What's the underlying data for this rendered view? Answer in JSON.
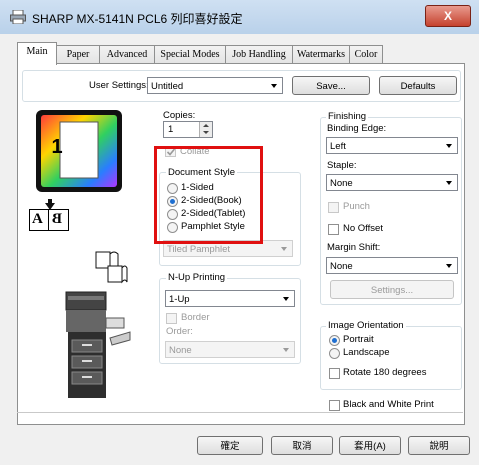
{
  "window": {
    "title": "SHARP MX-5141N PCL6 列印喜好設定",
    "close_label": "X"
  },
  "tabs": [
    "Main",
    "Paper",
    "Advanced",
    "Special Modes",
    "Job Handling",
    "Watermarks",
    "Color"
  ],
  "user_settings": {
    "label": "User Settings:",
    "value": "Untitled",
    "save_label": "Save...",
    "defaults_label": "Defaults"
  },
  "preview": {
    "page_number": "1",
    "book_letter_a": "A",
    "book_letter_b": "B"
  },
  "copies": {
    "label": "Copies:",
    "value": "1",
    "collate_label": "Collate"
  },
  "document_style": {
    "title": "Document Style",
    "options": [
      "1-Sided",
      "2-Sided(Book)",
      "2-Sided(Tablet)",
      "Pamphlet Style"
    ],
    "selected": "2-Sided(Book)",
    "hidden_combo_value": "Tiled Pamphlet"
  },
  "nup": {
    "title": "N-Up Printing",
    "value": "1-Up",
    "border_label": "Border",
    "order_label": "Order:",
    "order_value": "None"
  },
  "finishing": {
    "title": "Finishing",
    "binding_label": "Binding Edge:",
    "binding_value": "Left",
    "staple_label": "Staple:",
    "staple_value": "None",
    "punch_label": "Punch",
    "no_offset_label": "No Offset",
    "margin_label": "Margin Shift:",
    "margin_value": "None",
    "settings_label": "Settings..."
  },
  "orientation": {
    "title": "Image Orientation",
    "portrait": "Portrait",
    "landscape": "Landscape",
    "rotate_label": "Rotate 180 degrees"
  },
  "bw_label": "Black and White Print",
  "footer": {
    "ok": "確定",
    "cancel": "取消",
    "apply": "套用(A)",
    "help": "說明"
  },
  "colors": {
    "highlight": "#e01010",
    "radio_dot": "#1f6fd1"
  }
}
